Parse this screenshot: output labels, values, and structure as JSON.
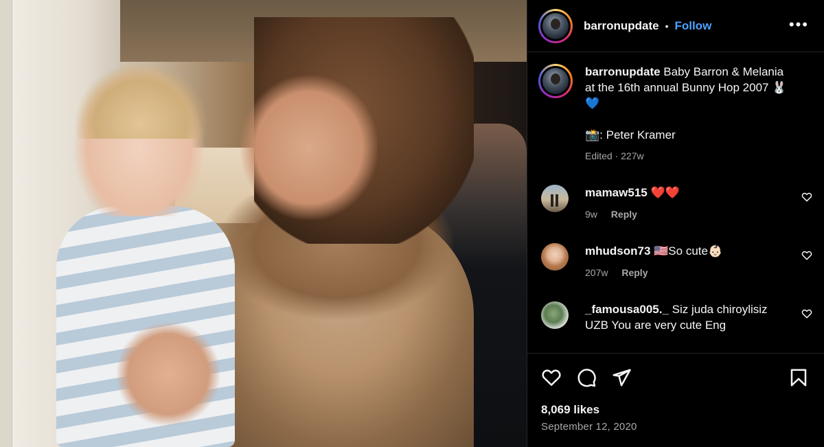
{
  "post": {
    "username": "barronupdate",
    "follow_label": "Follow",
    "more_label": "•••",
    "separator": "•",
    "caption": {
      "username": "barronupdate",
      "text": "Baby Barron & Melania at the 16th annual Bunny Hop 2007 🐰💙",
      "credit": "📸: Peter Kramer",
      "meta": "Edited · 227w"
    },
    "comments": [
      {
        "username": "mamaw515",
        "text": "❤️❤️",
        "age": "9w",
        "reply_label": "Reply"
      },
      {
        "username": "mhudson73",
        "text": "🇺🇸So cute👶🏻",
        "age": "207w",
        "reply_label": "Reply"
      },
      {
        "username": "_famousa005._",
        "text": "Siz juda chiroylisiz UZB You are very cute Eng",
        "age": "",
        "reply_label": ""
      }
    ],
    "likes": "8,069 likes",
    "date": "September 12, 2020"
  },
  "icons": [
    "heart-icon",
    "comment-icon",
    "share-icon",
    "bookmark-icon",
    "more-icon"
  ],
  "colors": {
    "background": "#000000",
    "accent": "#4aa3ff",
    "muted": "#a8a8a8",
    "text": "#f5f5f5"
  }
}
